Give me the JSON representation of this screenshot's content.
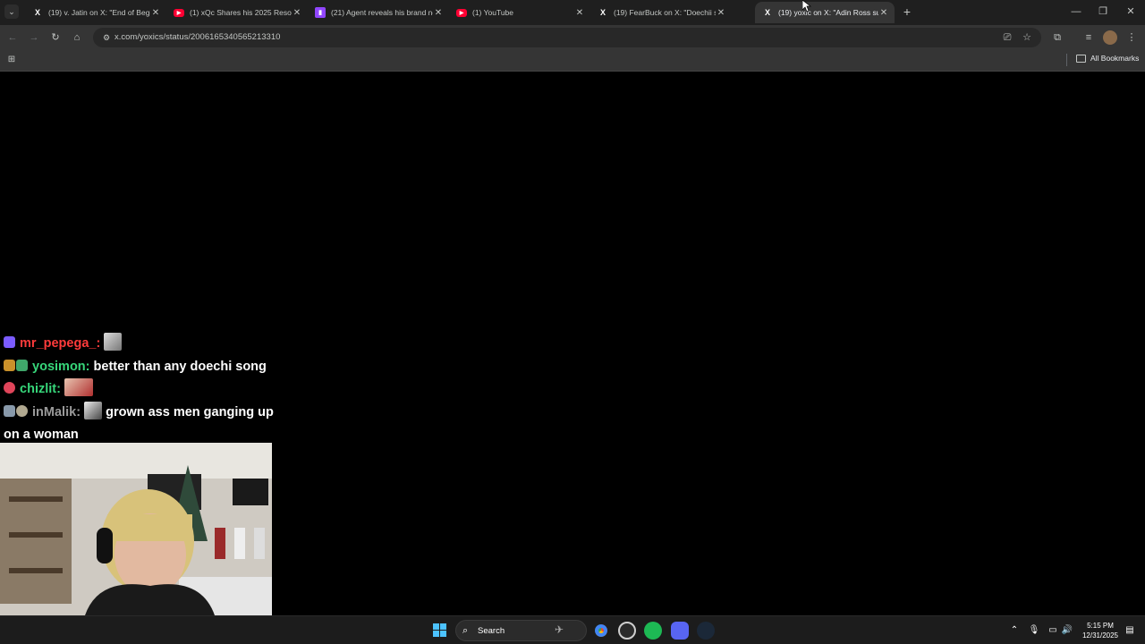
{
  "browser": {
    "tabs": [
      {
        "title": "(19) v. Jatin on X: \"End of Begin",
        "favicon": "x-icon",
        "active": false
      },
      {
        "title": "(1) xQc Shares his 2025 Resolut",
        "favicon": "youtube-icon",
        "active": false
      },
      {
        "title": "(21) Agent reveals his brand ne",
        "favicon": "twitch-icon",
        "active": false
      },
      {
        "title": "(1) YouTube",
        "favicon": "youtube-icon",
        "active": false
      },
      {
        "title": "(19) FearBuck on X: \"Doechii se",
        "favicon": "x-icon",
        "active": false
      },
      {
        "title": "(19) yoxic on X: \"Adin Ross surg",
        "favicon": "x-icon",
        "active": true
      }
    ],
    "url": "x.com/yoxics/status/2006165340565213310",
    "bookmarks_label": "All Bookmarks"
  },
  "chat": {
    "messages": [
      {
        "user": "mr_pepega_",
        "user_color": "#ff3b3b",
        "text": ""
      },
      {
        "user": "yosimon",
        "user_color": "#37d67a",
        "text": "better than any doechi song"
      },
      {
        "user": "chizlit",
        "user_color": "#37d67a",
        "text": ""
      },
      {
        "user": "inMalik",
        "user_color": "#9a9a9a",
        "text": "grown ass men ganging up on a woman"
      }
    ]
  },
  "taskbar": {
    "search_label": "Search",
    "time": "5:15 PM",
    "date": "12/31/2025"
  }
}
